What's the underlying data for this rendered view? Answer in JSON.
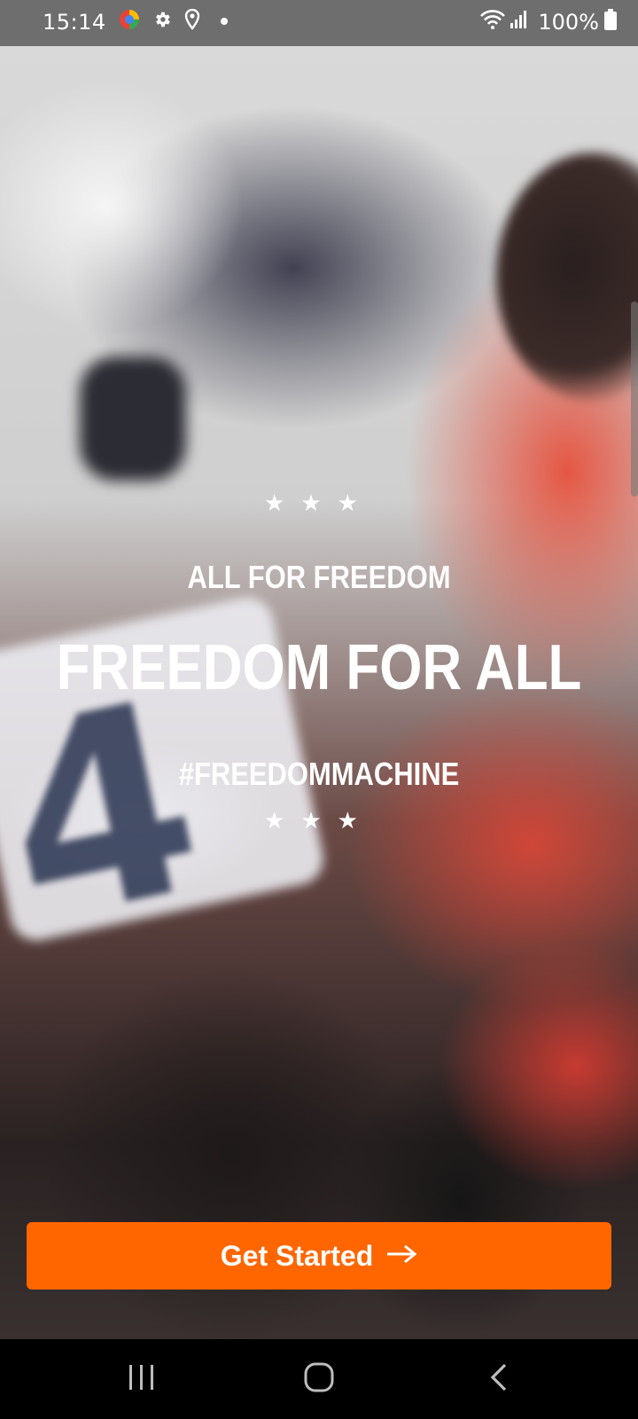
{
  "status_bar": {
    "time": "15:14",
    "battery": "100%",
    "icons": [
      "browser-app-icon",
      "gear-icon",
      "location-icon",
      "dot-icon",
      "wifi-icon",
      "signal-icon",
      "battery-icon"
    ]
  },
  "hero": {
    "stars_top": "★★★",
    "tagline": "ALL FOR FREEDOM",
    "title": "FREEDOM FOR ALL",
    "hashtag": "#FREEDOMMACHINE",
    "stars_bottom": "★★★",
    "background_number": "4"
  },
  "cta": {
    "label": "Get Started",
    "icon": "arrow-right-icon",
    "color": "#ff6600"
  },
  "nav_bar": {
    "buttons": [
      "recent-apps-icon",
      "home-icon",
      "back-icon"
    ]
  }
}
